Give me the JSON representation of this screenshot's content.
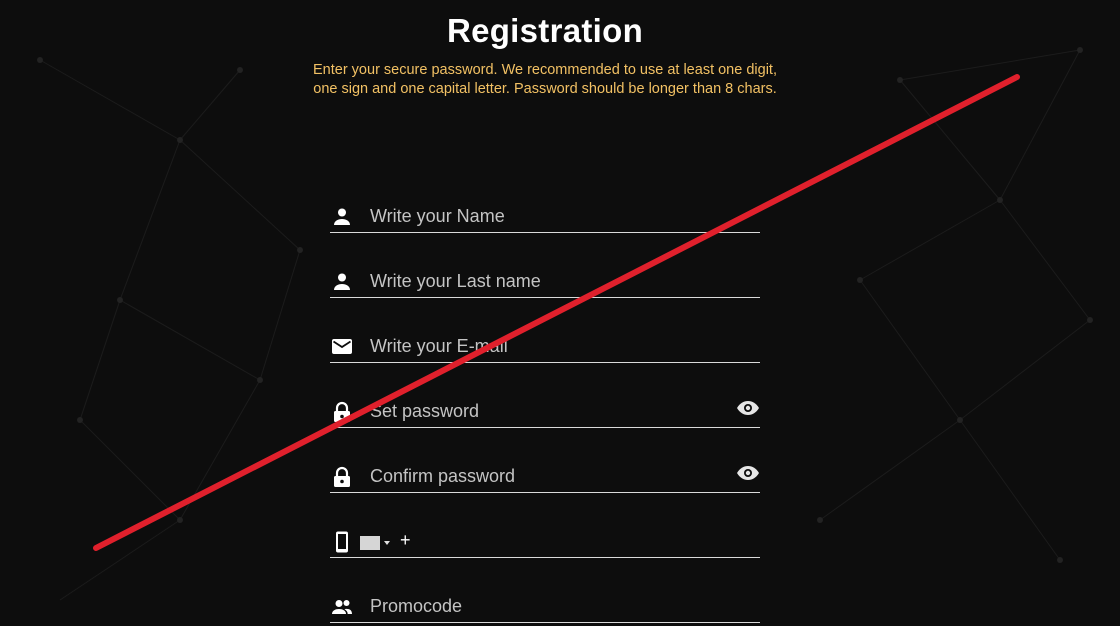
{
  "page": {
    "title": "Registration",
    "subtitle_line1": "Enter your secure password. We recommended to use at least one digit,",
    "subtitle_line2": "one sign and one capital letter. Password should be longer than 8 chars."
  },
  "form": {
    "first_name_placeholder": "Write your Name",
    "last_name_placeholder": "Write your Last name",
    "email_placeholder": "Write your E-mail",
    "password_placeholder": "Set password",
    "confirm_password_placeholder": "Confirm password",
    "phone_prefix": "+",
    "promocode_placeholder": "Promocode"
  },
  "icons": {
    "first_name": "person-icon",
    "last_name": "person-icon",
    "email": "mail-icon",
    "password": "lock-icon",
    "confirm_password": "lock-icon",
    "password_toggle": "eye-icon",
    "phone": "phone-icon",
    "country": "flag-icon",
    "promocode": "group-icon"
  },
  "colors": {
    "background": "#0d0d0d",
    "title": "#ffffff",
    "subtitle": "#f2c164",
    "placeholder": "#c4c4c4",
    "underline": "#d9d9d9",
    "strike": "#e0202c"
  }
}
